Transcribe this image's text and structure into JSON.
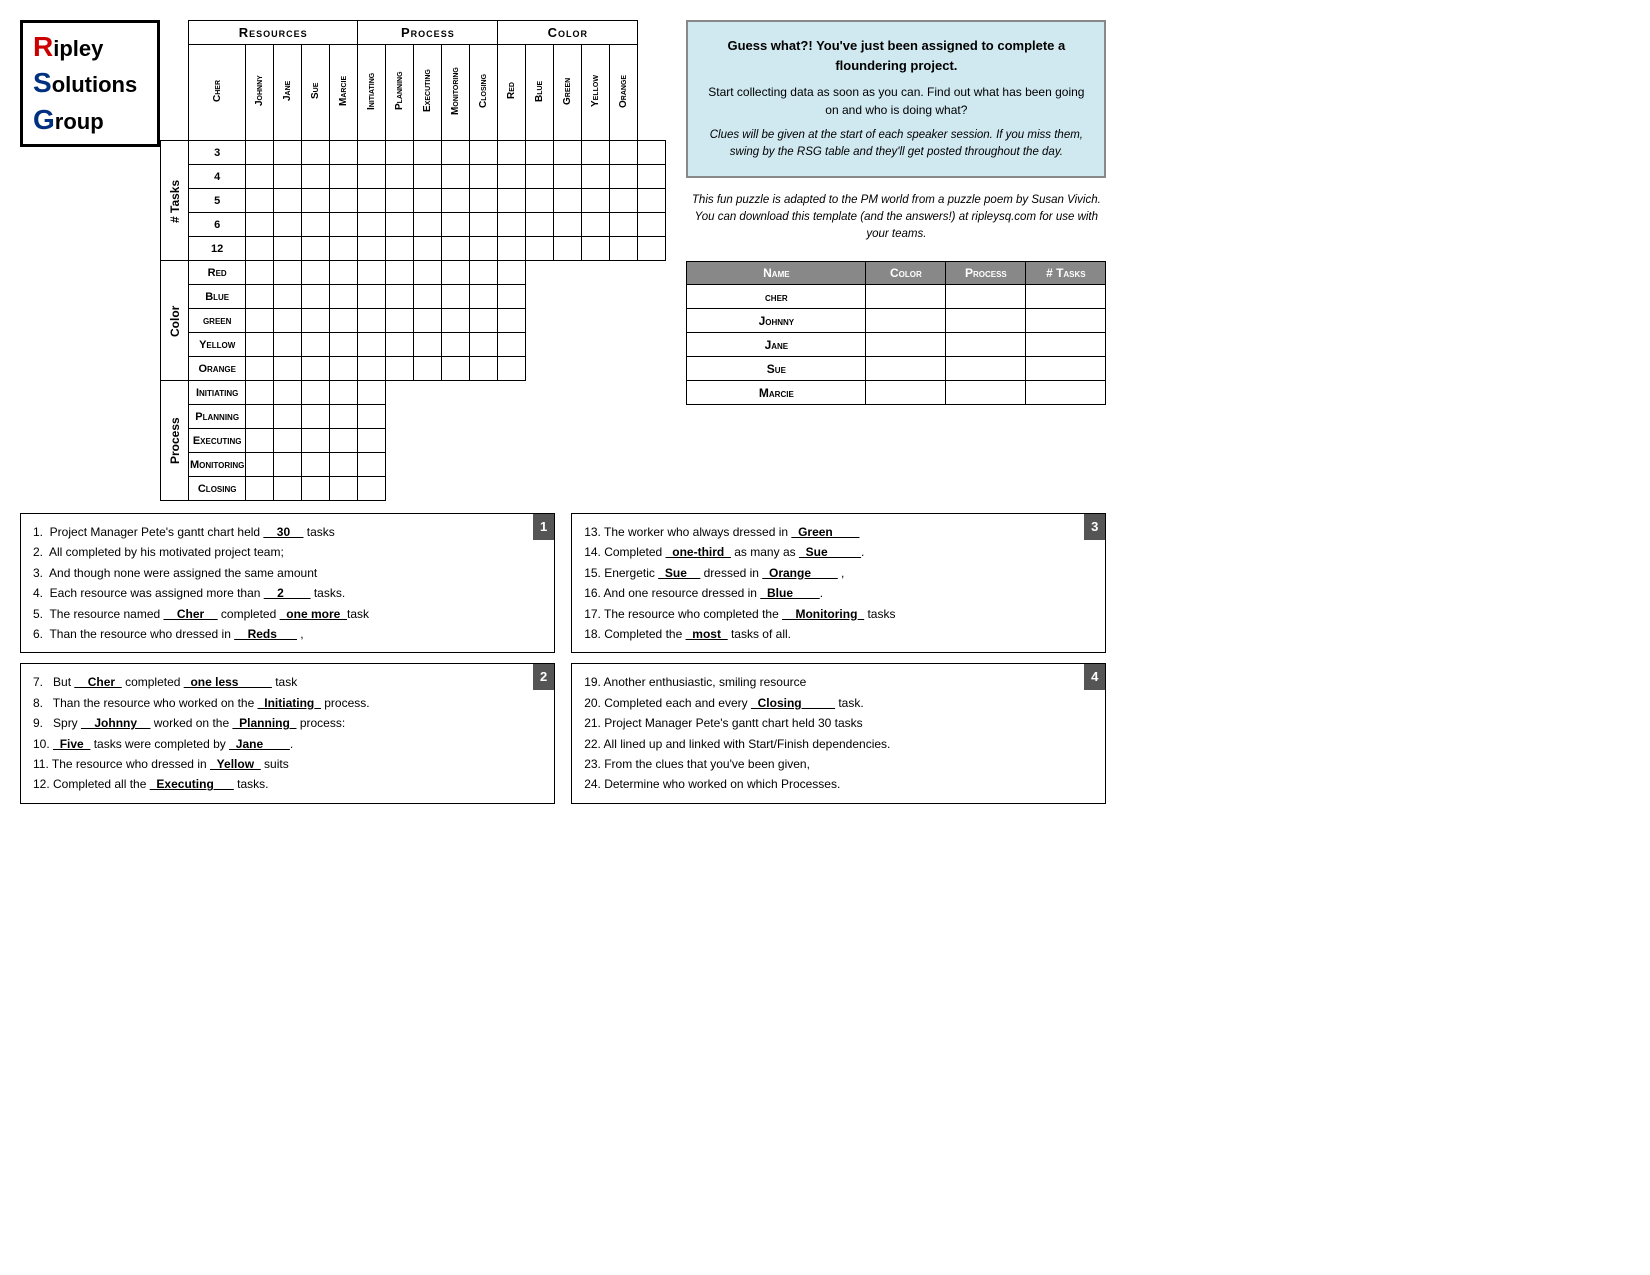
{
  "logo": {
    "line1": "ipley",
    "line2": "olutions",
    "line3": "roup",
    "r": "R",
    "s": "S",
    "g": "G"
  },
  "headers": {
    "resources": "Resources",
    "process": "Process",
    "color": "Color"
  },
  "columns": {
    "resources": [
      "Cher",
      "Johnny",
      "Jane",
      "Sue",
      "Marcie"
    ],
    "process": [
      "Initiating",
      "Planning",
      "Executing",
      "Monitoring",
      "Closing"
    ],
    "color": [
      "Red",
      "Blue",
      "Green",
      "Yellow",
      "Orange"
    ]
  },
  "rows": {
    "tasks": {
      "label": "# Tasks",
      "values": [
        "3",
        "4",
        "5",
        "6",
        "12"
      ]
    },
    "color": {
      "label": "Color",
      "values": [
        "Red",
        "Blue",
        "Green",
        "Yellow",
        "Orange"
      ]
    },
    "process": {
      "label": "Process",
      "values": [
        "Initiating",
        "Planning",
        "Executing",
        "Monitoring",
        "Closing"
      ]
    }
  },
  "infoBox": {
    "title": "Guess what?! You've just been assigned to complete a floundering project.",
    "body": "Start collecting data as soon as you can.  Find out what has been going on and who is doing what?",
    "italic": "Clues will be given at the start of each speaker session.  If you miss them, swing by the RSG table and they'll get posted throughout the day."
  },
  "infoBoxBottom": "This fun puzzle is adapted to the PM world from a puzzle poem by Susan Vivich.  You can download this template (and the answers!) at ripleysq.com for use with your teams.",
  "answerTable": {
    "headers": [
      "Name",
      "Color",
      "Process",
      "# Tasks"
    ],
    "rows": [
      {
        "name": "cher"
      },
      {
        "name": "Johnny"
      },
      {
        "name": "Jane"
      },
      {
        "name": "Sue"
      },
      {
        "name": "Marcie"
      }
    ]
  },
  "clues": {
    "box1": {
      "number": "1",
      "lines": [
        "1.  Project Manager Pete’s gantt chart held __30__ tasks",
        "2.  All completed by his motivated project team;",
        "3.  And though none were assigned the same amount",
        "4.  Each resource was assigned more than __2____ tasks.",
        "5.  The resource named __Cher__ completed _one more_task",
        "6.  Than the resource who dressed in __Reds___ ,"
      ]
    },
    "box2": {
      "number": "2",
      "lines": [
        "7.  But __Cher_ completed _one less_____ task",
        "8.  Than the resource who worked on the _Initiating_ process.",
        "9.  Spry __Johnny__ worked on the _Planning_ process:",
        "10. _Five_ tasks were completed by _Jane____.",
        "11. The resource who dressed in _Yellow_ suits",
        "12. Completed all the _Executing___ tasks."
      ]
    },
    "box3": {
      "number": "3",
      "lines": [
        "13. The worker who always dressed in _Green____",
        "14. Completed _one-third_ as many as _Sue_____.",
        "15. Energetic _Sue__ dressed in _Orange____ ,",
        "16. And one resource dressed in _Blue____.",
        "17. The resource who completed the __Monitoring_ tasks",
        "18. Completed the _most_ tasks of all."
      ]
    },
    "box4": {
      "number": "4",
      "lines": [
        "19. Another enthusiastic, smiling resource",
        "20. Completed each and every _Closing_____ task.",
        "21. Project Manager Pete’s gantt chart held 30 tasks",
        "22. All lined up and linked with Start/Finish dependencies.",
        "23. From the clues that you’ve been given,",
        "24. Determine who worked on which Processes."
      ]
    }
  }
}
